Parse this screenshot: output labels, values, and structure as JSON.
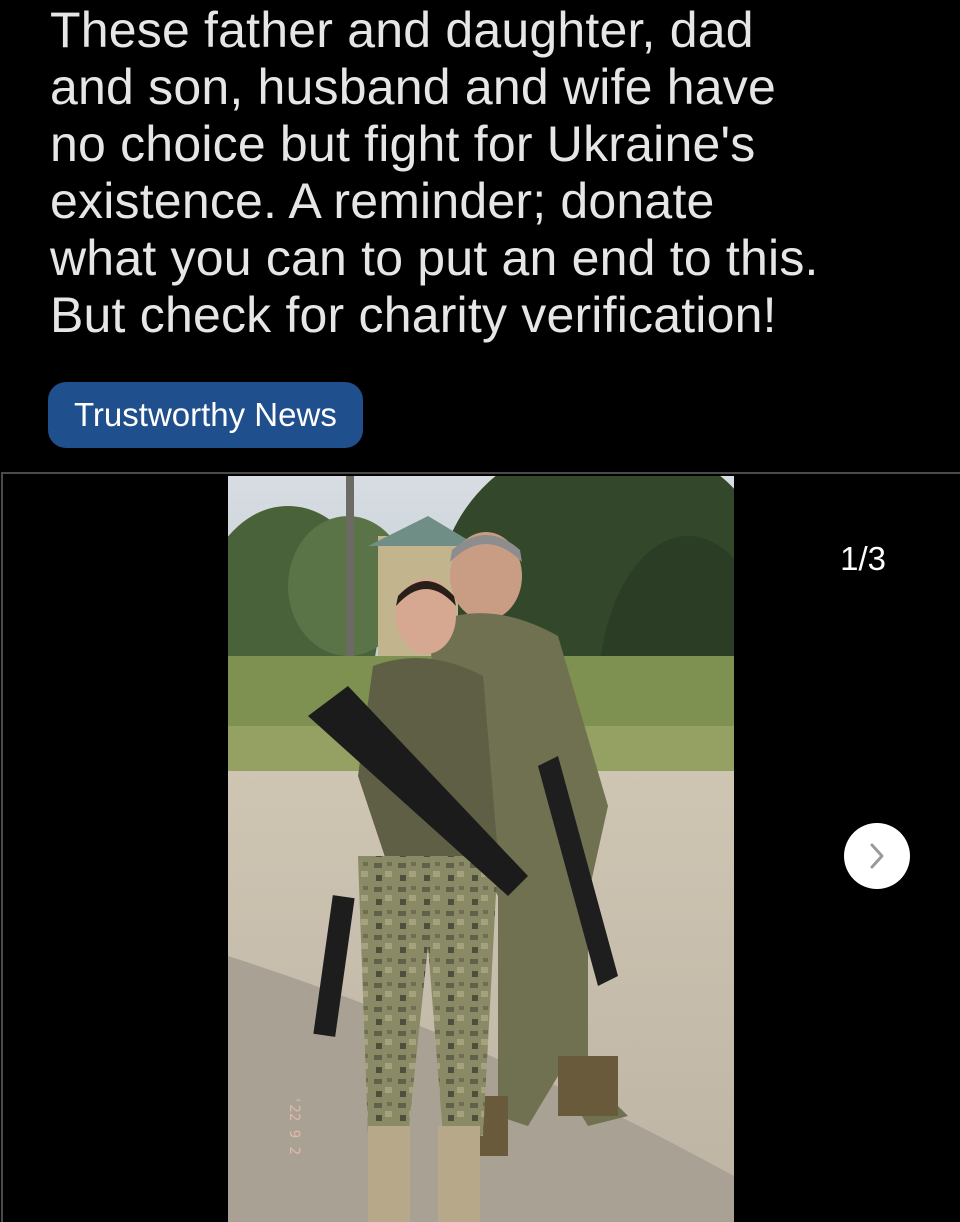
{
  "post": {
    "text": "These father and daughter, dad\nand son, husband and wife have\nno choice but fight for Ukraine's\nexistence. A reminder; donate\nwhat you can to put an end to this.\nBut check for charity verification!",
    "flair": "Trustworthy News"
  },
  "gallery": {
    "counter": "1/3",
    "next_icon": "chevron-right-icon",
    "current_index": 1,
    "total": 3
  },
  "colors": {
    "background": "#000000",
    "flair_bg": "#1f4f8c",
    "text": "#e6e6e6"
  }
}
